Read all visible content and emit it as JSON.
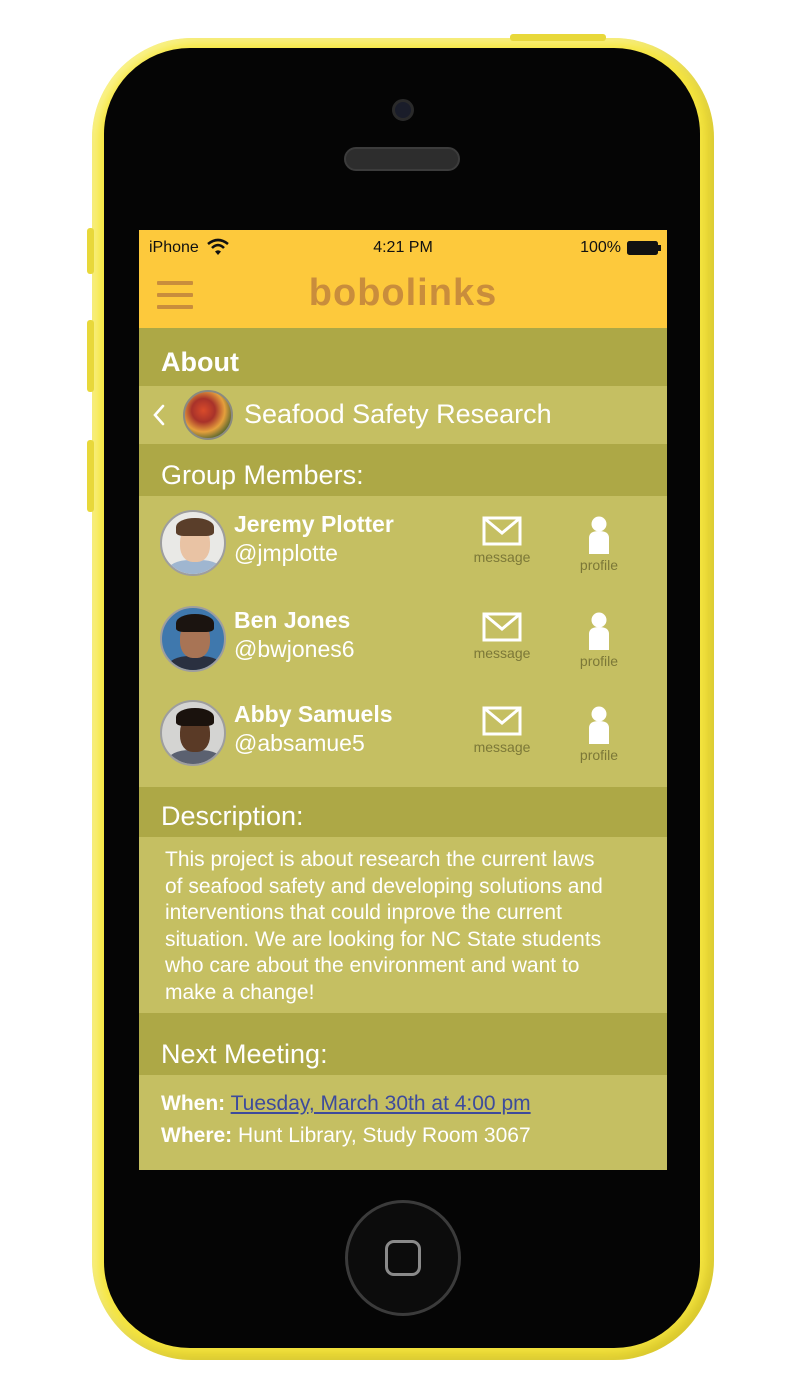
{
  "status_bar": {
    "carrier": "iPhone",
    "time": "4:21 PM",
    "battery": "100%"
  },
  "header": {
    "logo": "bobolinks",
    "menu_icon": "hamburger-menu-icon"
  },
  "about": {
    "title": "About",
    "group_name": "Seafood Safety Research",
    "back_icon": "chevron-left-icon"
  },
  "members": {
    "title": "Group Members:",
    "message_label": "message",
    "profile_label": "profile",
    "list": [
      {
        "name": "Jeremy Plotter",
        "handle": "@jmplotte"
      },
      {
        "name": "Ben Jones",
        "handle": "@bwjones6"
      },
      {
        "name": "Abby Samuels",
        "handle": "@absamue5"
      }
    ]
  },
  "description": {
    "title": "Description:",
    "lines": [
      "This project is about research the current laws",
      "of seafood safety and developing solutions and",
      "interventions that could inprove the current",
      "situation. We are looking for NC State students",
      "who care about the environment and want to",
      "make a change!"
    ]
  },
  "next_meeting": {
    "title": "Next Meeting:",
    "when_label": "When:",
    "when_value": "Tuesday, March 30th at 4:00 pm",
    "where_label": "Where:",
    "where_value": "Hunt Library, Study Room 3067"
  },
  "colors": {
    "phone_body": "#f6e640",
    "header": "#fdc93c",
    "logo": "#c98d3c",
    "section_band": "#ada846",
    "section_body": "#c5bf62",
    "link": "#3d4b9c"
  }
}
